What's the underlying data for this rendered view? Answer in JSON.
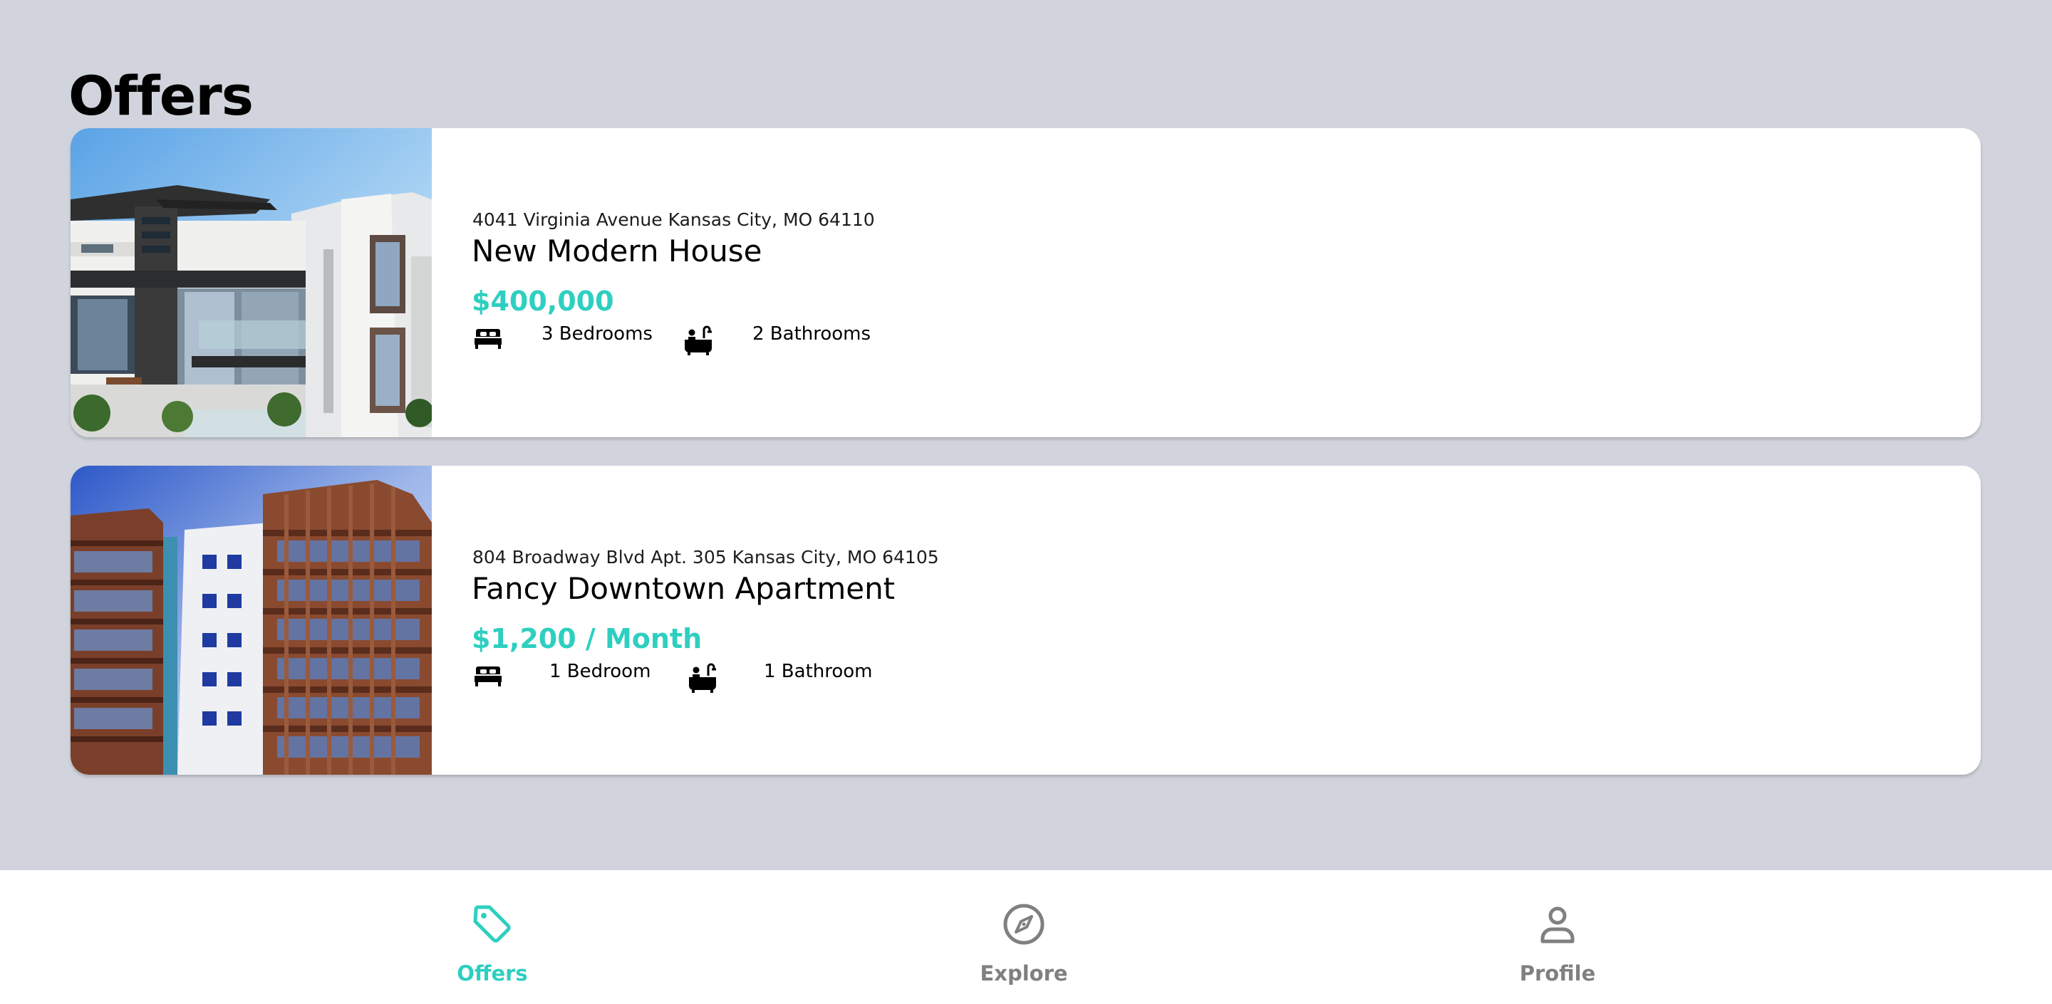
{
  "page": {
    "title": "Offers",
    "background_color": "#d1d4dc"
  },
  "colors": {
    "accent": "#2ecfc0",
    "nav_inactive": "#808080"
  },
  "listings": [
    {
      "address": "4041 Virginia Avenue Kansas City, MO 64110",
      "title": "New Modern House",
      "price": "$400,000",
      "bedrooms_label": "3 Bedrooms",
      "bathrooms_label": "2 Bathrooms",
      "bedroom_icon": "bed-icon",
      "bathroom_icon": "bathtub-icon",
      "image": "modern-house-photo"
    },
    {
      "address": "804 Broadway Blvd Apt. 305 Kansas City, MO 64105",
      "title": "Fancy Downtown Apartment",
      "price": "$1,200 / Month",
      "bedrooms_label": "1 Bedroom",
      "bathrooms_label": "1 Bathroom",
      "bedroom_icon": "bed-icon",
      "bathroom_icon": "bathtub-icon",
      "image": "apartment-building-photo"
    }
  ],
  "bottom_nav": {
    "items": [
      {
        "label": "Offers",
        "icon": "tag-icon",
        "active": true
      },
      {
        "label": "Explore",
        "icon": "compass-icon",
        "active": false
      },
      {
        "label": "Profile",
        "icon": "user-icon",
        "active": false
      }
    ]
  }
}
